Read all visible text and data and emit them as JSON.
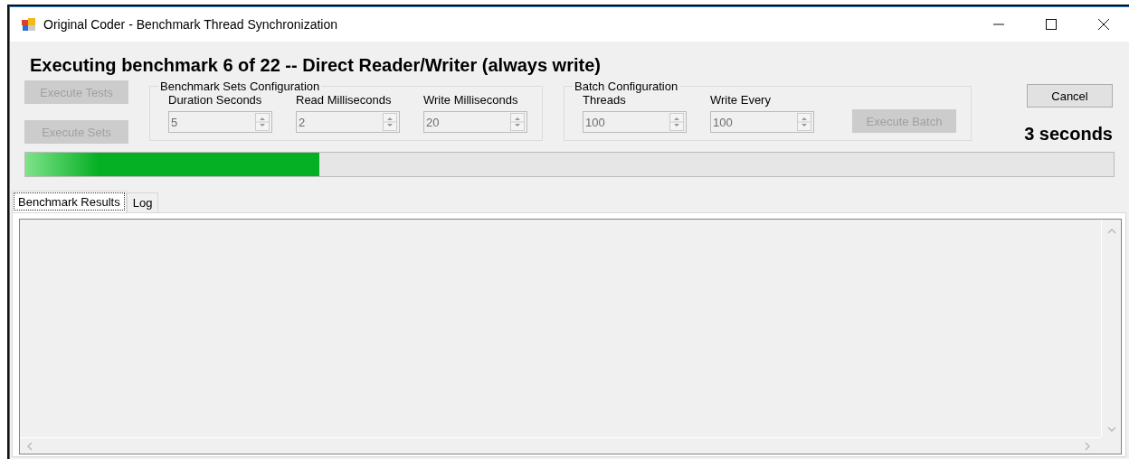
{
  "window": {
    "title": "Original Coder - Benchmark Thread Synchronization"
  },
  "heading": "Executing benchmark 6 of 22 -- Direct Reader/Writer (always write)",
  "side_buttons": [
    {
      "label": "Execute Tests",
      "disabled": true
    },
    {
      "label": "Execute Sets",
      "disabled": true
    }
  ],
  "groups": [
    {
      "title": "Benchmark Sets Configuration",
      "fields": [
        {
          "label": "Duration Seconds",
          "value": "5",
          "disabled": true
        },
        {
          "label": "Read Milliseconds",
          "value": "2",
          "disabled": true
        },
        {
          "label": "Write Milliseconds",
          "value": "20",
          "disabled": true
        }
      ]
    },
    {
      "title": "Batch Configuration",
      "fields": [
        {
          "label": "Threads",
          "value": "100",
          "disabled": true
        },
        {
          "label": "Write Every",
          "value": "100",
          "disabled": true
        }
      ],
      "button": {
        "label": "Execute Batch",
        "disabled": true
      }
    }
  ],
  "cancel_button": {
    "label": "Cancel",
    "disabled": false
  },
  "elapsed": "3 seconds",
  "progress": {
    "level": 0.27
  },
  "tabs": [
    {
      "label": "Benchmark Results",
      "selected": true
    },
    {
      "label": "Log",
      "selected": false
    }
  ]
}
